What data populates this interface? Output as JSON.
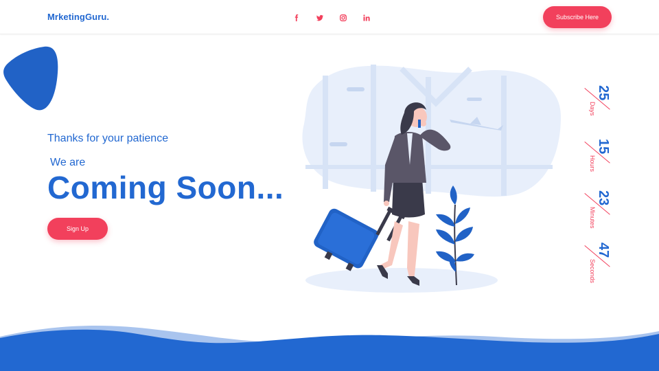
{
  "header": {
    "brand": "MrketingGuru.",
    "social": [
      {
        "icon": "facebook-icon",
        "glyph": "f"
      },
      {
        "icon": "twitter-icon",
        "glyph": "t"
      },
      {
        "icon": "instagram-icon",
        "glyph": "ig"
      },
      {
        "icon": "linkedin-icon",
        "glyph": "in"
      }
    ],
    "subscribe_label": "Subscribe Here"
  },
  "hero": {
    "tagline": "Thanks for your patience",
    "we_are": "We are",
    "headline": "Coming Soon...",
    "signup_label": "Sign Up"
  },
  "countdown": [
    {
      "value": "25",
      "unit": "Days"
    },
    {
      "value": "15",
      "unit": "Hours"
    },
    {
      "value": "23",
      "unit": "Minutes"
    },
    {
      "value": "47",
      "unit": "Seconds"
    }
  ],
  "colors": {
    "primary": "#2268d1",
    "accent": "#f2405c",
    "light_blue": "#e8effb"
  }
}
